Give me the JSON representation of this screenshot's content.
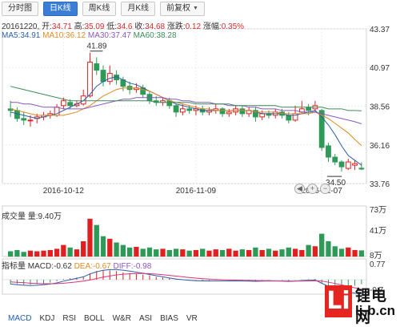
{
  "tabs": [
    {
      "label": "分时图",
      "active": false
    },
    {
      "label": "日K线",
      "active": true
    },
    {
      "label": "周K线",
      "active": false
    },
    {
      "label": "月K线",
      "active": false
    },
    {
      "label": "前复权",
      "active": false
    }
  ],
  "quote": {
    "date": "20161220",
    "open_label": "开:",
    "open": "34.71",
    "high_label": "高:",
    "high": "35.09",
    "low_label": "低:",
    "low": "34.6",
    "close_label": "收:",
    "close": "34.68",
    "change_label": "涨跌:",
    "change": "0.12",
    "pct_label": "涨幅:",
    "pct": "0.35%"
  },
  "ma": {
    "ma5": "MA5:34.91",
    "ma10": "MA10:36.12",
    "ma30": "MA30:37.47",
    "ma60": "MA60:38.28"
  },
  "volume_label": "成交量 量:9.40万",
  "macd": {
    "title": "指标量",
    "macd": "MACD:-0.62",
    "dea": "DEA:-0.67",
    "dif": "DIFF:-0.98"
  },
  "colors": {
    "up": "#e02020",
    "down": "#2e9a57",
    "ma5": "#2b5fa8",
    "ma10": "#e08a1e",
    "ma30": "#8a56c2",
    "ma60": "#3c8c5a",
    "tab_active": "#3a7fd5"
  },
  "bottom_tabs": [
    {
      "label": "MACD",
      "active": true
    },
    {
      "label": "KDJ",
      "active": false
    },
    {
      "label": "RSI",
      "active": false
    },
    {
      "label": "BOLL",
      "active": false
    },
    {
      "label": "W&R",
      "active": false
    },
    {
      "label": "ASI",
      "active": false
    },
    {
      "label": "BIAS",
      "active": false
    },
    {
      "label": "VR",
      "active": false
    }
  ],
  "nav_buttons": [
    "◀",
    "+",
    "−"
  ],
  "watermark": {
    "letter": "Li",
    "cn": "锂电网",
    "url": "li-b.cn"
  },
  "chart_data": {
    "type": "candlestick",
    "price_axis": {
      "ticks": [
        43.37,
        40.97,
        38.56,
        36.16,
        33.76
      ],
      "range": [
        33.76,
        43.37
      ]
    },
    "x_ticks": [
      "2016-10-12",
      "2016-11-09",
      "2016-12-07"
    ],
    "annotations": [
      {
        "label": "41.89",
        "type": "max"
      },
      {
        "label": "34.50",
        "type": "min"
      }
    ],
    "volume_axis": {
      "ticks": [
        "73万",
        "41万",
        "8万"
      ]
    },
    "macd_axis": {
      "ticks": [
        "0.77",
        "-0.7"
      ]
    },
    "candles": [
      [
        38.4,
        38.3,
        38.9,
        37.9
      ],
      [
        38.3,
        37.8,
        38.5,
        37.6
      ],
      [
        37.8,
        37.7,
        38.2,
        37.4
      ],
      [
        37.7,
        37.7,
        38.0,
        37.3
      ],
      [
        37.8,
        37.9,
        38.1,
        37.5
      ],
      [
        37.9,
        38.0,
        38.2,
        37.7
      ],
      [
        38.0,
        38.1,
        38.3,
        37.8
      ],
      [
        38.0,
        38.5,
        38.7,
        37.9
      ],
      [
        38.6,
        38.9,
        39.1,
        38.4
      ],
      [
        38.8,
        38.6,
        39.0,
        38.4
      ],
      [
        38.6,
        38.7,
        38.9,
        38.5
      ],
      [
        38.7,
        39.2,
        39.6,
        38.6
      ],
      [
        39.2,
        41.3,
        41.89,
        39.1
      ],
      [
        41.2,
        40.8,
        41.6,
        40.5
      ],
      [
        40.8,
        40.1,
        41.1,
        39.8
      ],
      [
        40.1,
        40.6,
        41.1,
        39.9
      ],
      [
        40.5,
        40.2,
        40.8,
        39.9
      ],
      [
        40.2,
        39.8,
        40.4,
        39.5
      ],
      [
        39.8,
        39.6,
        40.1,
        39.3
      ],
      [
        39.6,
        39.7,
        40.0,
        39.4
      ],
      [
        39.7,
        39.3,
        39.9,
        39.1
      ],
      [
        39.3,
        38.9,
        39.5,
        38.7
      ],
      [
        38.9,
        38.8,
        39.2,
        38.6
      ],
      [
        38.8,
        38.9,
        39.1,
        38.6
      ],
      [
        38.9,
        38.6,
        39.1,
        38.4
      ],
      [
        38.6,
        38.2,
        38.7,
        37.9
      ],
      [
        38.2,
        38.4,
        38.7,
        38.0
      ],
      [
        38.4,
        38.3,
        38.6,
        38.1
      ],
      [
        38.3,
        38.4,
        38.6,
        38.0
      ],
      [
        38.4,
        38.2,
        38.6,
        38.0
      ],
      [
        38.2,
        38.3,
        38.5,
        38.0
      ],
      [
        38.3,
        38.4,
        38.7,
        38.1
      ],
      [
        38.4,
        38.1,
        38.5,
        37.9
      ],
      [
        38.1,
        38.2,
        38.4,
        37.9
      ],
      [
        38.2,
        38.4,
        38.6,
        38.0
      ],
      [
        38.4,
        38.1,
        38.6,
        37.9
      ],
      [
        38.1,
        38.3,
        38.5,
        37.9
      ],
      [
        38.3,
        37.9,
        38.5,
        37.6
      ],
      [
        37.9,
        38.1,
        38.3,
        37.7
      ],
      [
        38.1,
        38.0,
        38.3,
        37.8
      ],
      [
        38.0,
        38.2,
        38.4,
        37.8
      ],
      [
        38.2,
        38.0,
        38.4,
        37.8
      ],
      [
        38.0,
        37.7,
        38.2,
        37.5
      ],
      [
        37.7,
        38.1,
        38.6,
        37.6
      ],
      [
        38.2,
        38.4,
        38.9,
        38.1
      ],
      [
        38.5,
        38.3,
        38.7,
        38.0
      ],
      [
        38.4,
        38.6,
        38.9,
        38.2
      ],
      [
        38.3,
        36.0,
        38.4,
        35.8
      ],
      [
        36.1,
        35.4,
        36.3,
        35.1
      ],
      [
        35.4,
        35.1,
        35.6,
        34.9
      ],
      [
        35.1,
        34.8,
        35.2,
        34.5
      ],
      [
        34.7,
        35.1,
        35.3,
        34.6
      ],
      [
        34.9,
        35.0,
        35.2,
        34.6
      ],
      [
        34.71,
        34.68,
        35.09,
        34.6
      ]
    ],
    "ma5": [
      38.2,
      38.1,
      38.0,
      37.9,
      37.8,
      37.9,
      38.0,
      38.1,
      38.3,
      38.5,
      38.7,
      38.9,
      39.3,
      39.8,
      40.1,
      40.3,
      40.4,
      40.2,
      40.0,
      39.9,
      39.7,
      39.5,
      39.3,
      39.1,
      38.9,
      38.7,
      38.6,
      38.5,
      38.4,
      38.3,
      38.3,
      38.3,
      38.3,
      38.3,
      38.3,
      38.3,
      38.3,
      38.2,
      38.1,
      38.1,
      38.1,
      38.1,
      38.0,
      38.0,
      38.1,
      38.2,
      38.3,
      37.9,
      37.4,
      36.8,
      36.1,
      35.5,
      35.2,
      34.91
    ],
    "ma10": [
      38.4,
      38.3,
      38.2,
      38.1,
      38.0,
      38.0,
      38.0,
      38.0,
      38.0,
      38.1,
      38.2,
      38.4,
      38.6,
      38.9,
      39.2,
      39.4,
      39.6,
      39.7,
      39.7,
      39.7,
      39.6,
      39.5,
      39.3,
      39.1,
      38.9,
      38.8,
      38.7,
      38.6,
      38.5,
      38.4,
      38.4,
      38.3,
      38.3,
      38.3,
      38.3,
      38.3,
      38.3,
      38.2,
      38.2,
      38.2,
      38.2,
      38.1,
      38.1,
      38.1,
      38.1,
      38.1,
      38.2,
      38.0,
      37.8,
      37.5,
      37.2,
      36.9,
      36.5,
      36.12
    ],
    "ma30": [
      38.8,
      38.8,
      38.7,
      38.7,
      38.6,
      38.5,
      38.5,
      38.5,
      38.4,
      38.4,
      38.4,
      38.4,
      38.5,
      38.6,
      38.7,
      38.8,
      38.9,
      39.0,
      39.0,
      39.1,
      39.1,
      39.1,
      39.1,
      39.1,
      39.0,
      39.0,
      38.9,
      38.9,
      38.8,
      38.8,
      38.8,
      38.7,
      38.7,
      38.6,
      38.6,
      38.6,
      38.5,
      38.5,
      38.4,
      38.4,
      38.4,
      38.3,
      38.3,
      38.3,
      38.2,
      38.2,
      38.2,
      38.1,
      38.0,
      37.9,
      37.8,
      37.7,
      37.6,
      37.47
    ],
    "ma60": [
      39.8,
      39.7,
      39.6,
      39.5,
      39.4,
      39.3,
      39.2,
      39.1,
      39.0,
      38.9,
      38.9,
      38.9,
      38.9,
      38.9,
      38.9,
      38.9,
      38.9,
      38.9,
      38.9,
      38.9,
      38.9,
      38.9,
      38.8,
      38.8,
      38.8,
      38.8,
      38.8,
      38.8,
      38.7,
      38.7,
      38.7,
      38.7,
      38.7,
      38.7,
      38.6,
      38.6,
      38.6,
      38.6,
      38.6,
      38.6,
      38.6,
      38.5,
      38.5,
      38.5,
      38.5,
      38.5,
      38.5,
      38.5,
      38.4,
      38.4,
      38.4,
      38.3,
      38.3,
      38.28
    ],
    "volumes": [
      8,
      10,
      7,
      9,
      8,
      9,
      10,
      12,
      18,
      14,
      11,
      24,
      60,
      50,
      32,
      28,
      22,
      18,
      14,
      15,
      12,
      14,
      11,
      12,
      10,
      12,
      11,
      9,
      10,
      12,
      9,
      11,
      10,
      12,
      9,
      11,
      10,
      14,
      10,
      12,
      9,
      11,
      14,
      12,
      10,
      18,
      16,
      36,
      24,
      16,
      12,
      14,
      10,
      9.4
    ],
    "macd_bars": [
      -0.3,
      -0.3,
      -0.35,
      -0.35,
      -0.3,
      -0.25,
      -0.2,
      -0.1,
      0.05,
      0.1,
      0.15,
      0.2,
      0.45,
      0.6,
      0.65,
      0.65,
      0.6,
      0.5,
      0.45,
      0.4,
      0.35,
      0.3,
      0.2,
      0.15,
      0.1,
      0.05,
      0.02,
      -0.02,
      -0.04,
      -0.06,
      -0.04,
      -0.02,
      -0.03,
      -0.05,
      -0.04,
      -0.04,
      -0.03,
      -0.05,
      -0.03,
      -0.02,
      -0.01,
      -0.03,
      -0.06,
      -0.02,
      0.02,
      0.03,
      0.05,
      -0.25,
      -0.45,
      -0.55,
      -0.6,
      -0.5,
      -0.42,
      -0.31
    ],
    "dif": [
      -0.3,
      -0.35,
      -0.38,
      -0.4,
      -0.38,
      -0.35,
      -0.3,
      -0.22,
      -0.1,
      0.0,
      0.1,
      0.2,
      0.4,
      0.55,
      0.65,
      0.7,
      0.7,
      0.66,
      0.6,
      0.52,
      0.45,
      0.36,
      0.28,
      0.2,
      0.12,
      0.05,
      0.0,
      -0.04,
      -0.07,
      -0.08,
      -0.08,
      -0.08,
      -0.08,
      -0.09,
      -0.09,
      -0.09,
      -0.1,
      -0.11,
      -0.1,
      -0.09,
      -0.09,
      -0.1,
      -0.12,
      -0.1,
      -0.06,
      -0.04,
      -0.02,
      -0.25,
      -0.45,
      -0.62,
      -0.76,
      -0.86,
      -0.93,
      -0.98
    ],
    "dea": [
      -0.15,
      -0.18,
      -0.2,
      -0.24,
      -0.26,
      -0.28,
      -0.28,
      -0.27,
      -0.24,
      -0.2,
      -0.15,
      -0.1,
      -0.02,
      0.08,
      0.18,
      0.26,
      0.33,
      0.38,
      0.41,
      0.43,
      0.43,
      0.42,
      0.39,
      0.35,
      0.3,
      0.25,
      0.2,
      0.15,
      0.11,
      0.07,
      0.04,
      0.02,
      0.0,
      -0.02,
      -0.03,
      -0.04,
      -0.05,
      -0.06,
      -0.07,
      -0.07,
      -0.08,
      -0.08,
      -0.09,
      -0.09,
      -0.09,
      -0.08,
      -0.07,
      -0.1,
      -0.17,
      -0.26,
      -0.36,
      -0.46,
      -0.56,
      -0.67
    ]
  }
}
